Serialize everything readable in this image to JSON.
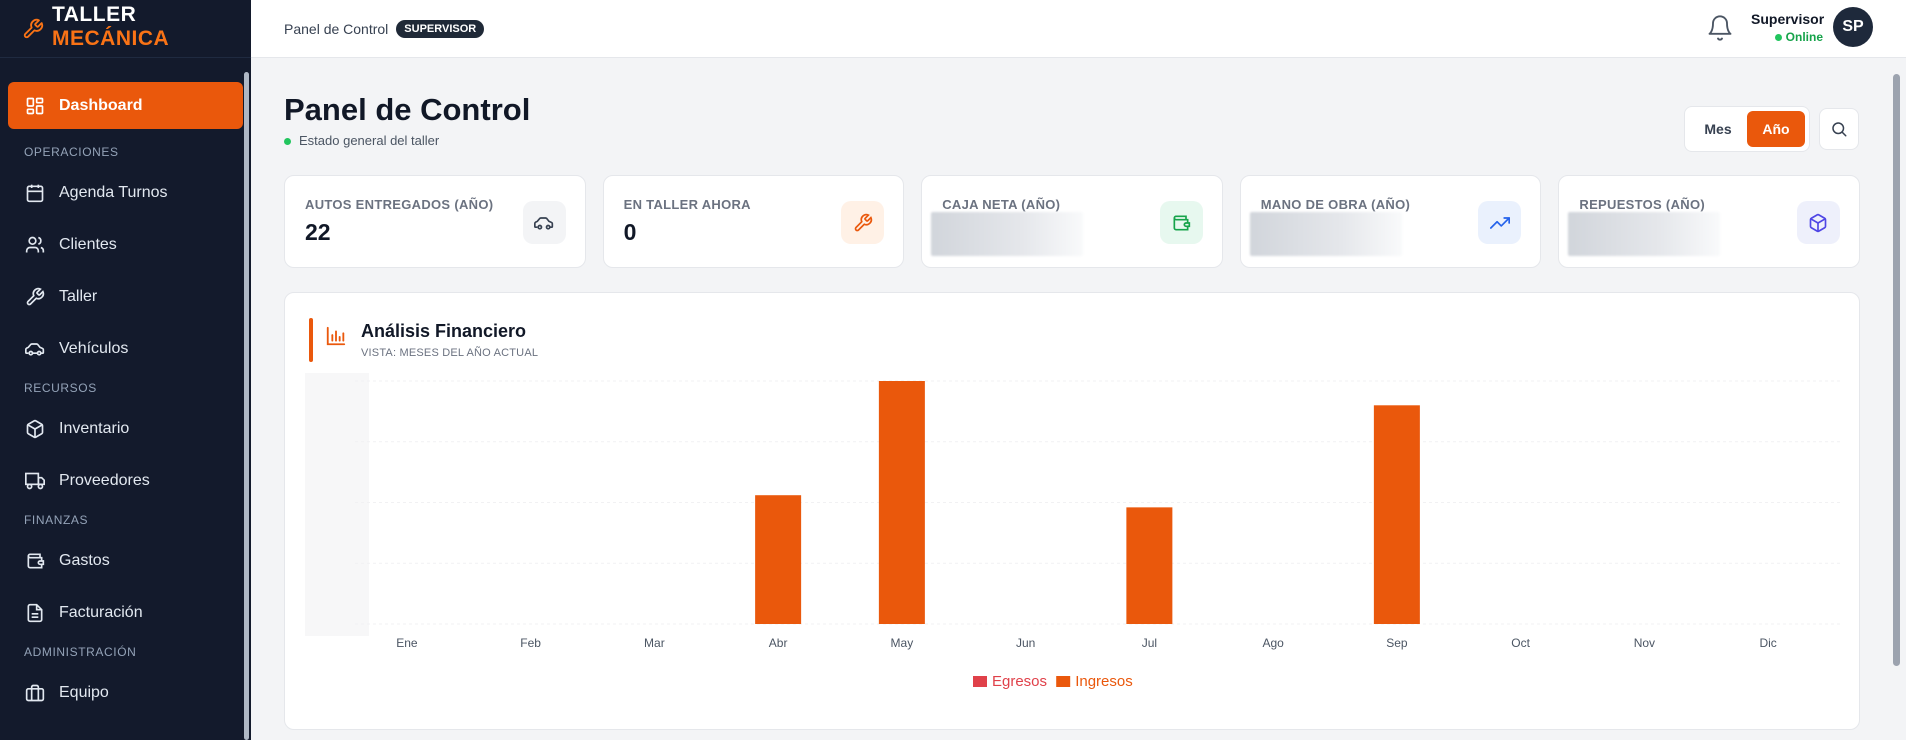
{
  "brand": {
    "line1": "TALLER",
    "line2": "MECÁNICA"
  },
  "sidebar": {
    "items": [
      {
        "label": "Dashboard",
        "icon": "grid-icon",
        "active": true
      },
      {
        "section": "OPERACIONES"
      },
      {
        "label": "Agenda Turnos",
        "icon": "calendar-icon"
      },
      {
        "label": "Clientes",
        "icon": "users-icon"
      },
      {
        "label": "Taller",
        "icon": "wrench-icon"
      },
      {
        "label": "Vehículos",
        "icon": "car-icon"
      },
      {
        "section": "RECURSOS"
      },
      {
        "label": "Inventario",
        "icon": "box-icon"
      },
      {
        "label": "Proveedores",
        "icon": "truck-icon"
      },
      {
        "section": "FINANZAS"
      },
      {
        "label": "Gastos",
        "icon": "wallet-icon"
      },
      {
        "label": "Facturación",
        "icon": "file-icon"
      },
      {
        "section": "ADMINISTRACIÓN"
      },
      {
        "label": "Equipo",
        "icon": "briefcase-icon"
      }
    ]
  },
  "topbar": {
    "breadcrumb": "Panel de Control",
    "role": "SUPERVISOR",
    "user_name": "Supervisor",
    "user_status": "Online",
    "avatar_initials": "SP"
  },
  "page": {
    "title": "Panel de Control",
    "subtitle": "Estado general del taller",
    "toggle": {
      "mes": "Mes",
      "anio": "Año",
      "selected": "Año"
    }
  },
  "kpis": [
    {
      "label": "AUTOS ENTREGADOS (AÑO)",
      "value": "22",
      "icon": "car-icon",
      "icon_bg": "#f3f4f6",
      "icon_color": "#374151"
    },
    {
      "label": "EN TALLER AHORA",
      "value": "0",
      "icon": "wrench-icon",
      "icon_bg": "#fff1e6",
      "icon_color": "#ea580c"
    },
    {
      "label": "CAJA NETA (AÑO)",
      "value": null,
      "icon": "wallet-icon",
      "icon_bg": "#e7f8ef",
      "icon_color": "#16a34a"
    },
    {
      "label": "MANO DE OBRA (AÑO)",
      "value": null,
      "icon": "trending-up-icon",
      "icon_bg": "#eaf1fd",
      "icon_color": "#2563eb"
    },
    {
      "label": "REPUESTOS (AÑO)",
      "value": null,
      "icon": "cube-icon",
      "icon_bg": "#eef0fb",
      "icon_color": "#4f46e5"
    }
  ],
  "chart": {
    "title": "Análisis Financiero",
    "subtitle": "VISTA: MESES DEL AÑO ACTUAL"
  },
  "chart_data": {
    "type": "bar",
    "categories": [
      "Ene",
      "Feb",
      "Mar",
      "Abr",
      "May",
      "Jun",
      "Jul",
      "Ago",
      "Sep",
      "Oct",
      "Nov",
      "Dic"
    ],
    "series": [
      {
        "name": "Egresos",
        "color": "#e0414a",
        "values": [
          0,
          0,
          0,
          0,
          0,
          0,
          0,
          0,
          0,
          0,
          0,
          0
        ]
      },
      {
        "name": "Ingresos",
        "color": "#ea580c",
        "values": [
          0,
          0,
          0,
          53,
          100,
          0,
          48,
          0,
          90,
          0,
          0,
          0
        ]
      }
    ],
    "legend": "bottom-center",
    "grid": true
  }
}
